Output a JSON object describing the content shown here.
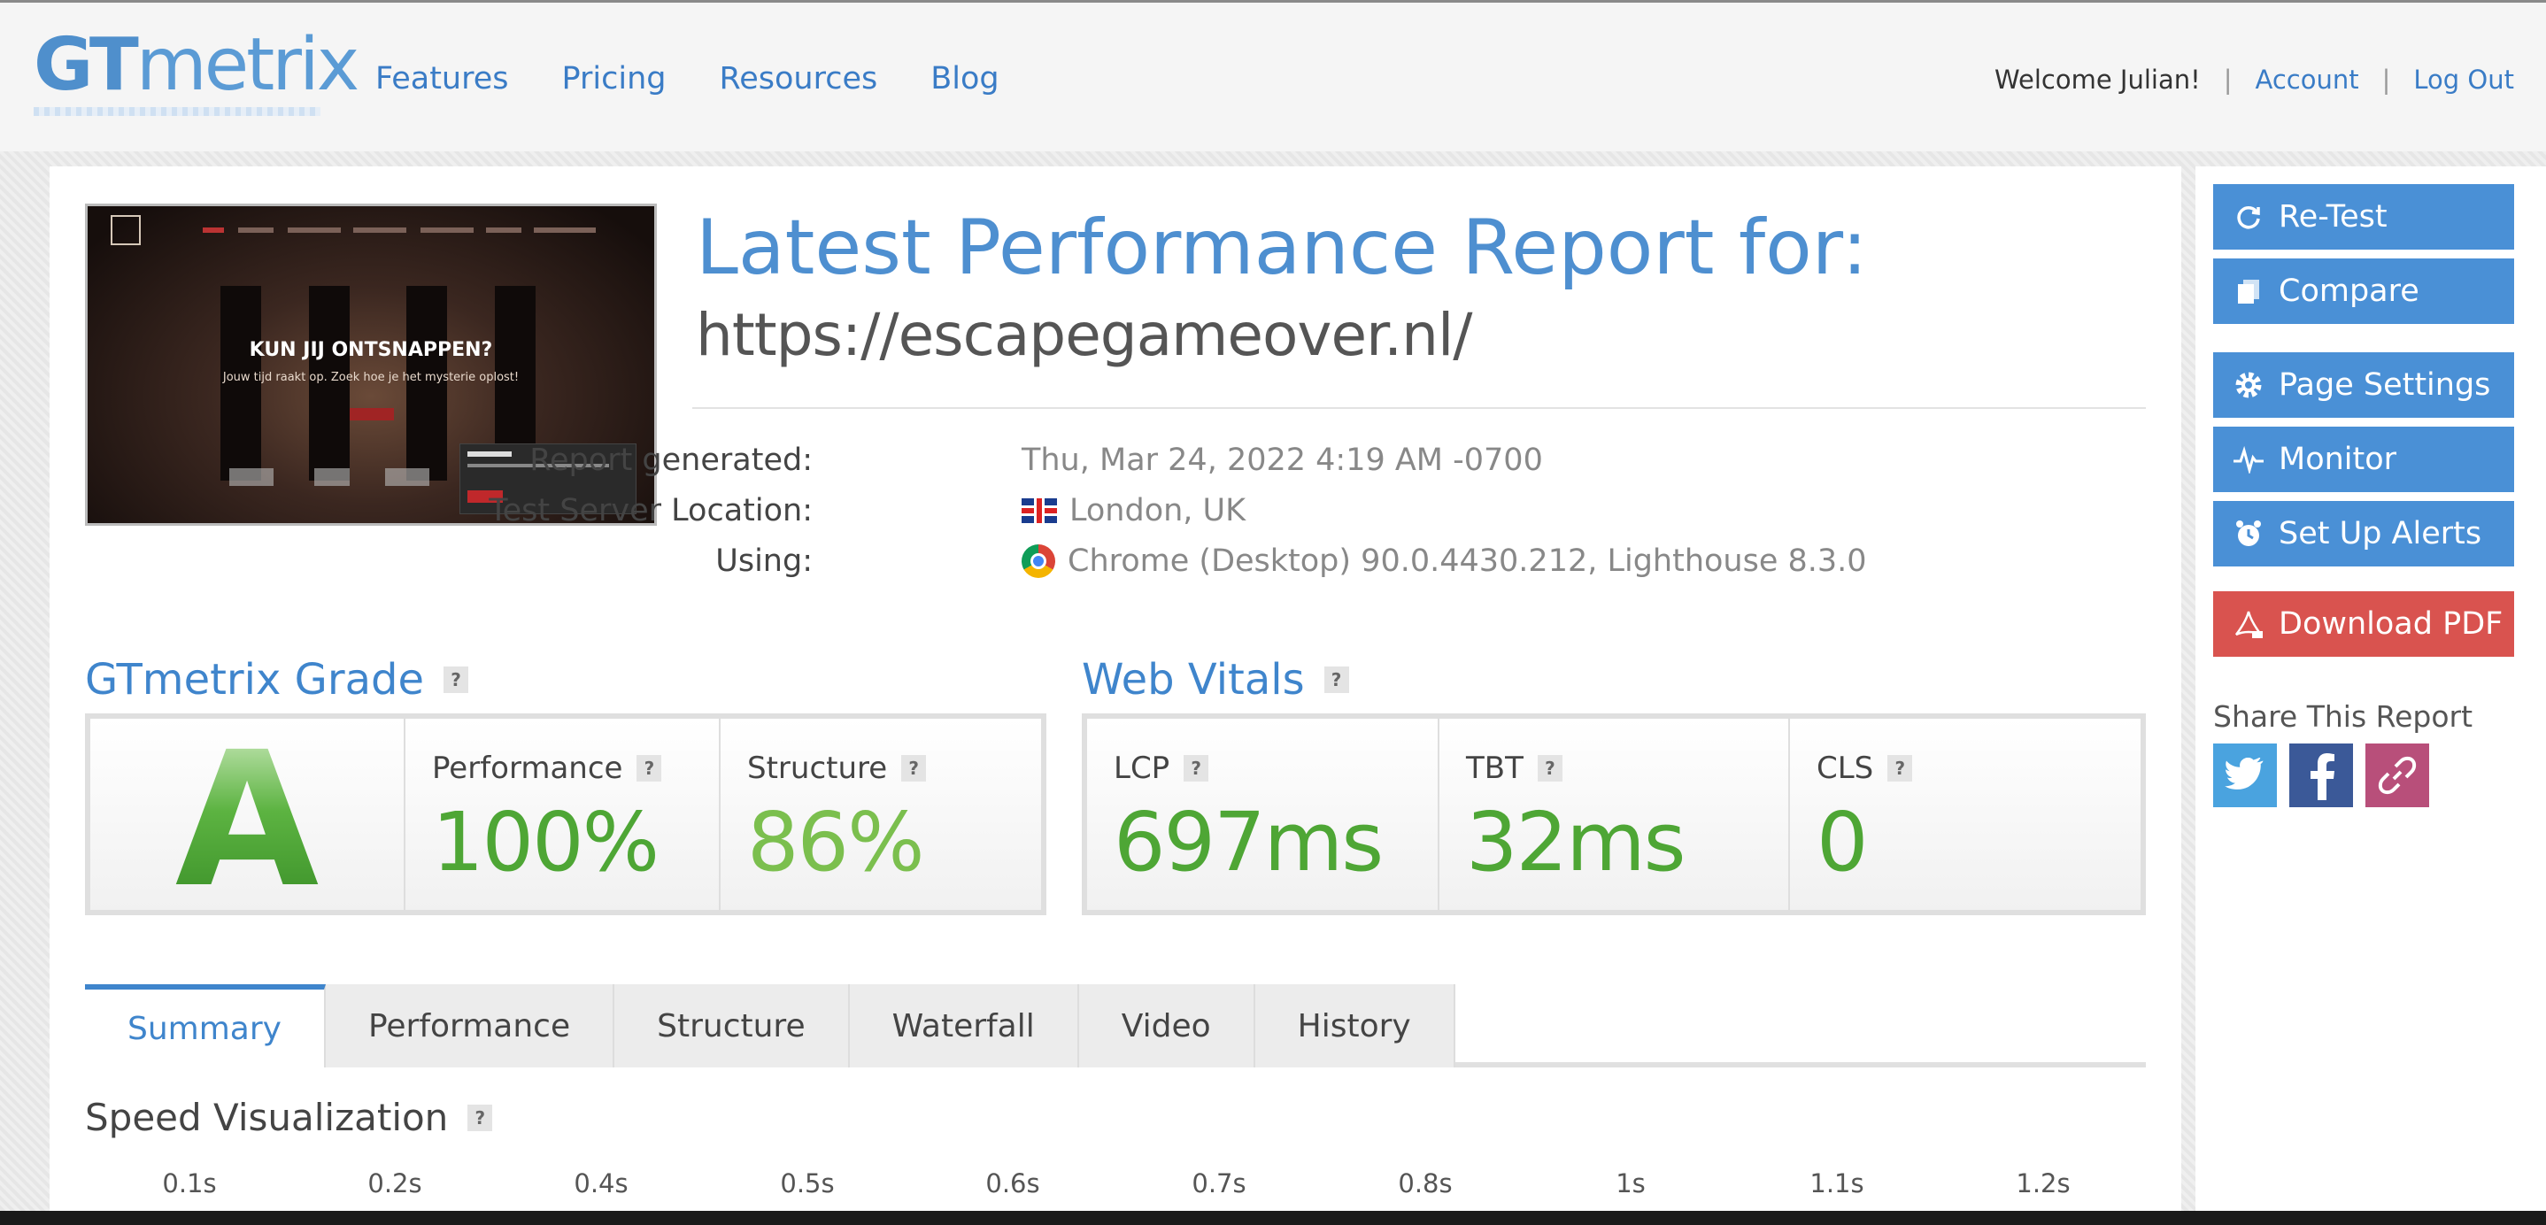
{
  "header": {
    "logo_gt": "GT",
    "logo_rest": "metrix",
    "nav": [
      "Features",
      "Pricing",
      "Resources",
      "Blog"
    ],
    "welcome": "Welcome Julian!",
    "account": "Account",
    "logout": "Log Out",
    "separator": "|"
  },
  "thumbnail": {
    "headline": "KUN JIJ ONTSNAPPEN?",
    "subline": "Jouw tijd raakt op. Zoek hoe je het mysterie oplost!"
  },
  "report": {
    "title": "Latest Performance Report for:",
    "url": "https://escapegameover.nl/",
    "generated_label": "Report generated:",
    "generated_value": "Thu, Mar 24, 2022 4:19 AM -0700",
    "location_label": "Test Server Location:",
    "location_value": "London, UK",
    "using_label": "Using:",
    "using_value": "Chrome (Desktop) 90.0.4430.212, Lighthouse 8.3.0"
  },
  "grade": {
    "title": "GTmetrix Grade",
    "letter": "A",
    "performance_label": "Performance",
    "performance_value": "100%",
    "structure_label": "Structure",
    "structure_value": "86%"
  },
  "vitals": {
    "title": "Web Vitals",
    "lcp_label": "LCP",
    "lcp_value": "697ms",
    "tbt_label": "TBT",
    "tbt_value": "32ms",
    "cls_label": "CLS",
    "cls_value": "0"
  },
  "help": "?",
  "tabs": [
    "Summary",
    "Performance",
    "Structure",
    "Waterfall",
    "Video",
    "History"
  ],
  "speed": {
    "title": "Speed Visualization",
    "ticks": [
      "0.1s",
      "0.2s",
      "0.4s",
      "0.5s",
      "0.6s",
      "0.7s",
      "0.8s",
      "1s",
      "1.1s",
      "1.2s"
    ]
  },
  "sidebar": {
    "retest": "Re-Test",
    "compare": "Compare",
    "page_settings": "Page Settings",
    "monitor": "Monitor",
    "alerts": "Set Up Alerts",
    "download": "Download PDF",
    "share_title": "Share This Report"
  },
  "colors": {
    "brand_blue": "#4e8fd0",
    "grade_green": "#4ea635",
    "pdf_red": "#d9534f"
  }
}
